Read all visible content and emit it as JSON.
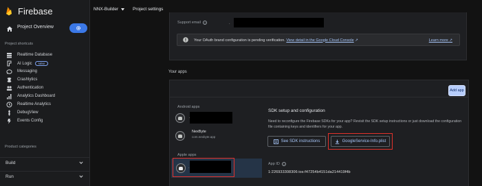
{
  "brand": {
    "name": "Firebase"
  },
  "topbar": {
    "project_name": "NNX-Builder",
    "settings_label": "Project settings"
  },
  "sidebar": {
    "project_overview": "Project Overview",
    "shortcuts_label": "Project shortcuts",
    "items": [
      {
        "label": "Realtime Database",
        "icon": "database-icon"
      },
      {
        "label": "AI Logic",
        "icon": "ai-logic-icon",
        "badge": "NEW"
      },
      {
        "label": "Messaging",
        "icon": "messaging-icon"
      },
      {
        "label": "Crashlytics",
        "icon": "crashlytics-icon"
      },
      {
        "label": "Authentication",
        "icon": "authentication-icon"
      },
      {
        "label": "Analytics Dashboard",
        "icon": "analytics-icon"
      },
      {
        "label": "Realtime Analytics",
        "icon": "realtime-analytics-icon"
      },
      {
        "label": "DebugView",
        "icon": "debugview-icon"
      },
      {
        "label": "Events Config",
        "icon": "events-icon"
      }
    ],
    "categories_label": "Product categories",
    "groups": [
      {
        "label": "Build"
      },
      {
        "label": "Run"
      }
    ]
  },
  "support": {
    "label": "Support email",
    "oauth_text": "Your OAuth brand configuration is pending verification.",
    "oauth_link": "View detail in the Google Cloud Console",
    "learn_more": "Learn more"
  },
  "apps": {
    "section_title": "Your apps",
    "add_app": "Add app",
    "android_label": "Android apps",
    "apple_label": "Apple apps",
    "android_apps": [
      {
        "name": "",
        "id": ""
      },
      {
        "name": "NexByte",
        "id": "com.nexbyte.app"
      }
    ],
    "sdk_title": "SDK setup and configuration",
    "sdk_desc": "Need to reconfigure the Firebase SDKs for your app? Revisit the SDK setup instructions or just download the configuration file containing keys and identifiers for your app.",
    "see_sdk": "See SDK instructions",
    "download_plist": "GoogleService-Info.plist",
    "app_id_label": "App ID",
    "app_id_value": "1:226933308306:ios:f47254b4151da214419f4b"
  },
  "colors": {
    "accent": "#3b78e7",
    "highlight": "#e4322b",
    "link": "#a8c7fa",
    "selected_row": "#253447"
  }
}
